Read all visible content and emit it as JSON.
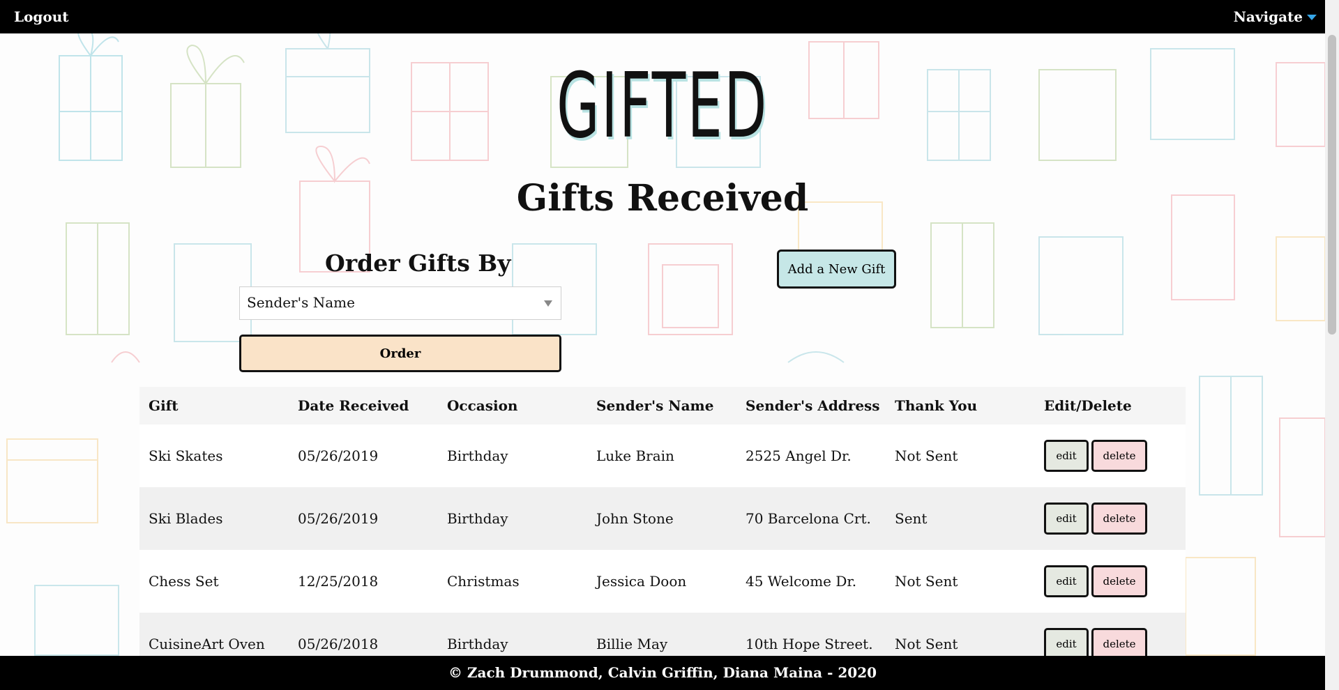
{
  "header": {
    "logout": "Logout",
    "navigate": "Navigate"
  },
  "logo": "GIFTED",
  "page_title": "Gifts Received",
  "order": {
    "heading": "Order Gifts By",
    "selected": "Sender's Name",
    "button": "Order"
  },
  "add_button": "Add a New Gift",
  "table": {
    "columns": [
      "Gift",
      "Date Received",
      "Occasion",
      "Sender's Name",
      "Sender's Address",
      "Thank You",
      "Edit/Delete"
    ],
    "rows": [
      {
        "gift": "Ski Skates",
        "date": "05/26/2019",
        "occasion": "Birthday",
        "sender": "Luke Brain",
        "address": "2525 Angel Dr.",
        "thanks": "Not Sent"
      },
      {
        "gift": "Ski Blades",
        "date": "05/26/2019",
        "occasion": "Birthday",
        "sender": "John Stone",
        "address": "70 Barcelona Crt.",
        "thanks": "Sent"
      },
      {
        "gift": "Chess Set",
        "date": "12/25/2018",
        "occasion": "Christmas",
        "sender": "Jessica Doon",
        "address": "45 Welcome Dr.",
        "thanks": "Not Sent"
      },
      {
        "gift": "CuisineArt Oven",
        "date": "05/26/2018",
        "occasion": "Birthday",
        "sender": "Billie May",
        "address": "10th Hope Street.",
        "thanks": "Not Sent"
      }
    ],
    "edit_label": "edit",
    "delete_label": "delete"
  },
  "footer": "© Zach Drummond, Calvin Griffin, Diana Maina - 2020",
  "colors": {
    "topbar": "#000000",
    "caret": "#36a6e8",
    "order_button": "#fae3c8",
    "add_button": "#c6e7e7",
    "edit_button": "#e5e9e1",
    "delete_button": "#f8dadc"
  }
}
